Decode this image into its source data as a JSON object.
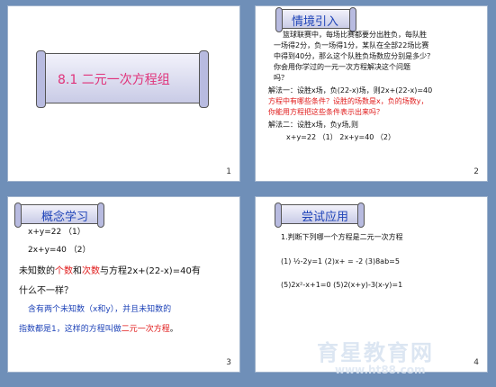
{
  "slide1": {
    "title": "8.1   二元一次方程组",
    "number": "1"
  },
  "slide2": {
    "title": "情境引入",
    "number": "2",
    "lines": [
      "篮球联赛中，每场比赛都要分出胜负，每队胜",
      "一场得2分，负一场得1分，某队在全部22场比赛",
      "中得到40分，那么这个队胜负场数应分别是多少？",
      "你会用你学过的一元一次方程解决这个问题",
      "吗？",
      "解法一：设胜x场，负(22-x)场，则2x+(22-x)=40",
      "方程中有哪些条件？设胜的场数是x，负的场数y，",
      "你能用方程把这些条件表示出来吗？",
      "解法二：设胜x场，负y场,则",
      "x+y=22   （1）       2x+y=40  （2）"
    ]
  },
  "slide3": {
    "title": "概念学习",
    "number": "3",
    "eq1": "x+y=22    （1）",
    "eq2": "2x+y=40    （2）",
    "q_part1": "未知数的",
    "q_red1": "个数",
    "q_part2": "和",
    "q_red2": "次数",
    "q_part3": "与方程2x+(22-x)=40有",
    "q_line2": "什么不一样？",
    "def_line1": "含有两个未知数（x和y），并且未知数的",
    "def_line2_blue": "指数都是1，这样的方程叫做",
    "def_line2_red": "二元一次方程",
    "def_line2_end": "。"
  },
  "slide4": {
    "title": "尝试应用",
    "number": "4",
    "question": "1.判断下列哪一个方程是二元一次方程",
    "row1": "(1)  ½-2y=1     (2)x+  = -2     (3)8ab=5",
    "row2": "(5)2x²-x+1=0   (5)2(x+y)-3(x-y)=1"
  },
  "watermark": {
    "text": "育星教育网",
    "url": "www.ht88.com"
  }
}
